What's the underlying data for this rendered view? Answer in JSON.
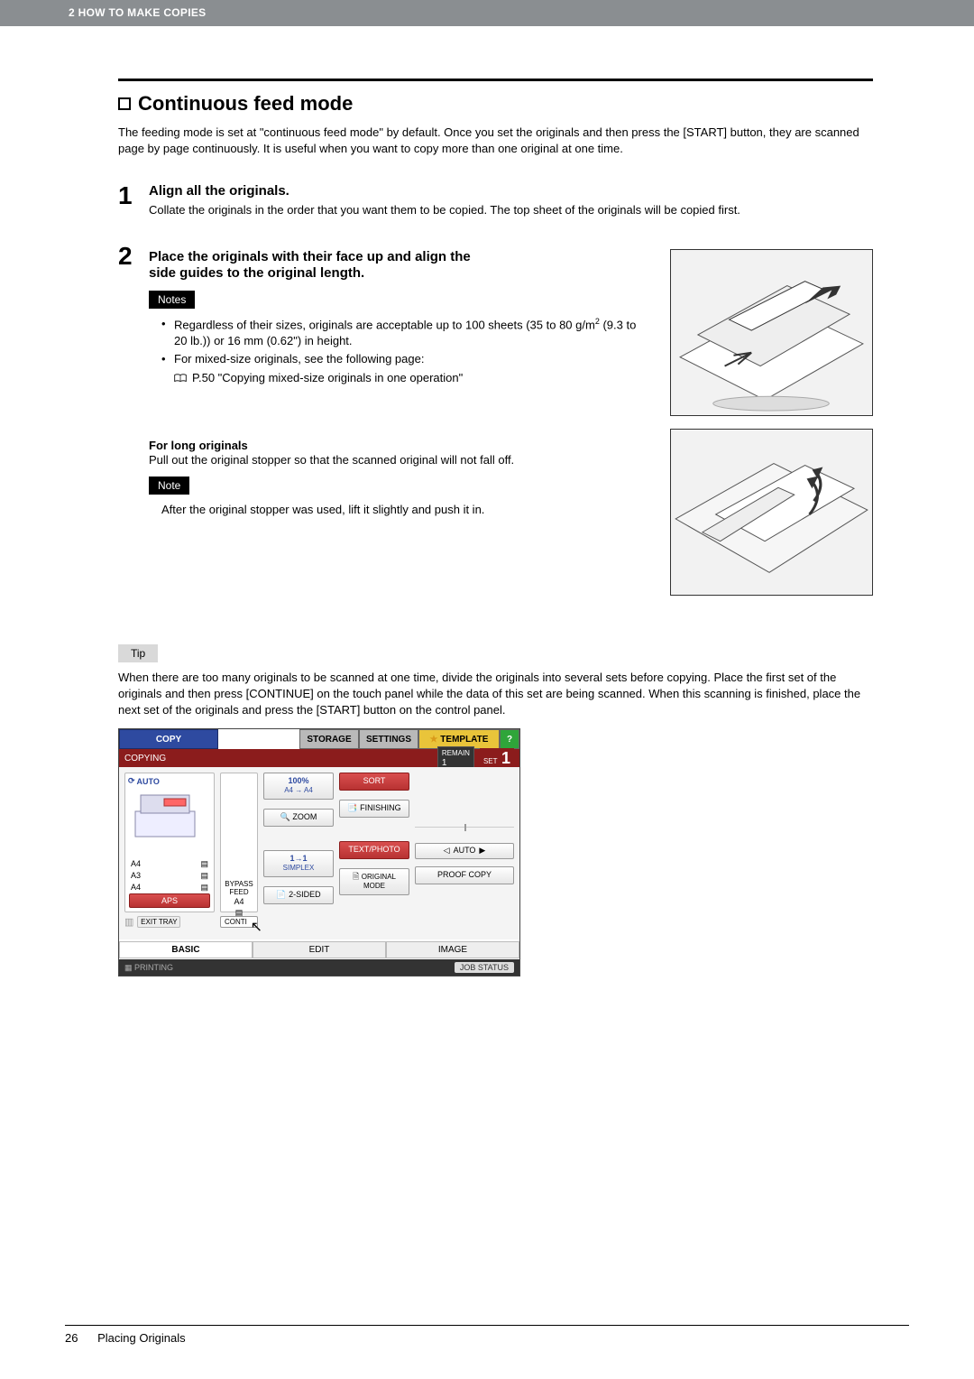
{
  "header": {
    "breadcrumb": "2 HOW TO MAKE COPIES"
  },
  "section": {
    "title": "Continuous feed mode",
    "intro": "The feeding mode is set at \"continuous feed mode\" by default. Once you set the originals and then press the [START] button, they are scanned page by page continuously. It is useful when you want to copy more than one original at one time."
  },
  "steps": [
    {
      "num": "1",
      "title": "Align all the originals.",
      "text": "Collate the originals in the order that you want them to be copied. The top sheet of the originals will be copied first."
    },
    {
      "num": "2",
      "title_l1": "Place the originals with their face up and align the",
      "title_l2": "side guides to the original length.",
      "notes_label": "Notes",
      "bullet1a": "Regardless of their sizes, originals are acceptable up to 100 sheets (35 to 80 g/m",
      "bullet1b": " (9.3 to 20 lb.)) or 16 mm (0.62\") in height.",
      "bullet2": "For mixed-size originals, see the following page:",
      "refpage": "P.50 \"Copying mixed-size originals in one operation\"",
      "longhead": "For long originals",
      "longtext": "Pull out the original stopper so that the scanned original will not fall off.",
      "note_label": "Note",
      "notetext": "After the original stopper was used, lift it slightly and push it in."
    }
  ],
  "tip": {
    "label": "Tip",
    "text": "When there are too many originals to be scanned at one time, divide the originals into several sets before copying. Place the first set of the originals and then press [CONTINUE] on the touch panel while the data of this set are being scanned. When this scanning is finished, place the next set of the originals and press the [START] button on the control panel."
  },
  "ui": {
    "tabs": {
      "copy": "COPY",
      "storage": "STORAGE",
      "settings": "SETTINGS",
      "template": "TEMPLATE",
      "help": "?"
    },
    "status_left": "COPYING",
    "status_remain_lbl": "REMAIN",
    "status_remain_val": "1",
    "status_set_lbl": "SET",
    "status_set_val": "1",
    "auto_label": "AUTO",
    "papers": {
      "a4_1": "A4",
      "a3": "A3",
      "a4_2": "A4",
      "a4_3": "A4"
    },
    "exit_tray": "EXIT TRAY",
    "aps": "APS",
    "bypass": "BYPASS FEED",
    "conti": "CONTI",
    "zoom_hdr": "100%",
    "zoom_sub": "A4 → A4",
    "zoom": "ZOOM",
    "simplex_hdr": "1→1",
    "simplex_sub": "SIMPLEX",
    "sided": "2-SIDED",
    "sort": "SORT",
    "finishing": "FINISHING",
    "textphoto": "TEXT/PHOTO",
    "origmode": "ORIGINAL MODE",
    "auto_d": "AUTO",
    "proof": "PROOF COPY",
    "bottom_tabs": {
      "basic": "BASIC",
      "edit": "EDIT",
      "image": "IMAGE"
    },
    "footer_left": "PRINTING",
    "job_status": "JOB STATUS"
  },
  "footer": {
    "page": "26",
    "section": "Placing Originals"
  }
}
